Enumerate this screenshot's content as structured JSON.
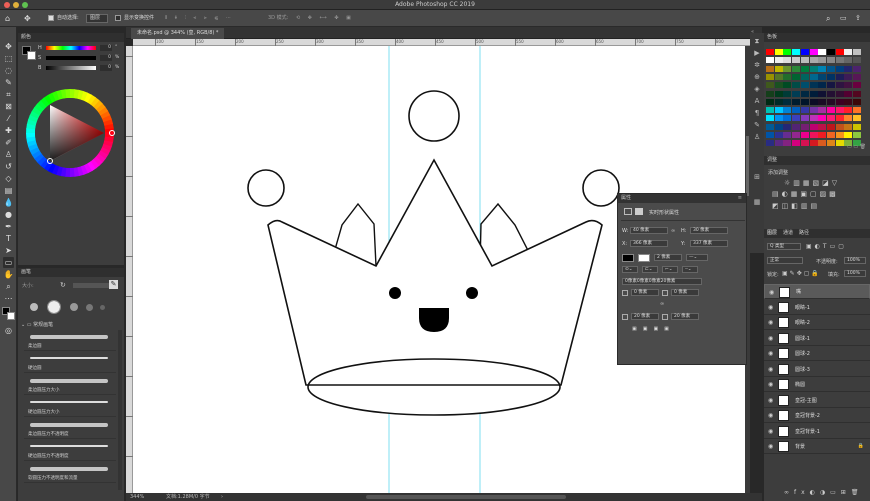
{
  "app": {
    "title": "Adobe Photoshop CC 2019"
  },
  "options": {
    "auto_select_label": "自动选择:",
    "auto_select_value": "图层",
    "transform_label": "显示变换控件",
    "mode_label": "3D 模式:"
  },
  "document": {
    "tab": "未命名.psd @ 344% (皇, RGB/8) *",
    "zoom": "344%",
    "status": "文档:1.28M/0 字节"
  },
  "ruler": {
    "ticks": [
      "100",
      "150",
      "200",
      "250",
      "300",
      "350",
      "400",
      "450",
      "500",
      "550",
      "600",
      "650",
      "700",
      "750",
      "800"
    ]
  },
  "color_panel": {
    "title": "颜色",
    "rows": [
      {
        "label": "H",
        "value": "0",
        "unit": "°"
      },
      {
        "label": "S",
        "value": "0",
        "unit": "%"
      },
      {
        "label": "B",
        "value": "0",
        "unit": "%"
      }
    ]
  },
  "brush_panel": {
    "title": "画笔",
    "size_label": "大小:",
    "group": "常规画笔",
    "brushes": [
      "柔边圆",
      "硬边圆",
      "柔边圆压力大小",
      "硬边圆压力大小",
      "柔边圆压力不透明度",
      "硬边圆压力不透明度",
      "软圆压力不透明度和流量"
    ]
  },
  "properties": {
    "title": "属性",
    "subtitle": "实时形状属性",
    "w_label": "W:",
    "w": "40 像素",
    "h_label": "H:",
    "h": "30 像素",
    "x_label": "X:",
    "x": "366 像素",
    "y_label": "Y:",
    "y": "337 像素",
    "stroke_width": "2 像素",
    "corners_line": "0像素0像素0像素20像素",
    "c1": "0 像素",
    "c2": "0 像素",
    "c3": "20 像素",
    "c4": "20 像素"
  },
  "swatches": {
    "title": "色板"
  },
  "adjustments": {
    "title": "调整",
    "subtitle": "添加调整"
  },
  "layers": {
    "tabs": [
      "图层",
      "通道",
      "路径"
    ],
    "filter": "Q 类型",
    "blend": "正常",
    "opacity_label": "不透明度:",
    "opacity": "100%",
    "lock_label": "锁定:",
    "fill_label": "填充:",
    "fill": "100%",
    "items": [
      {
        "name": "嘴",
        "selected": true,
        "locked": false
      },
      {
        "name": "眼睛-1",
        "selected": false,
        "locked": false
      },
      {
        "name": "眼睛-2",
        "selected": false,
        "locked": false
      },
      {
        "name": "圆球-1",
        "selected": false,
        "locked": false
      },
      {
        "name": "圆球-2",
        "selected": false,
        "locked": false
      },
      {
        "name": "圆球-3",
        "selected": false,
        "locked": false
      },
      {
        "name": "椭圆",
        "selected": false,
        "locked": false
      },
      {
        "name": "皇冠-主图",
        "selected": false,
        "locked": false
      },
      {
        "name": "皇冠背景-2",
        "selected": false,
        "locked": false
      },
      {
        "name": "皇冠背景-1",
        "selected": false,
        "locked": false
      },
      {
        "name": "背景",
        "selected": false,
        "locked": true
      }
    ]
  }
}
